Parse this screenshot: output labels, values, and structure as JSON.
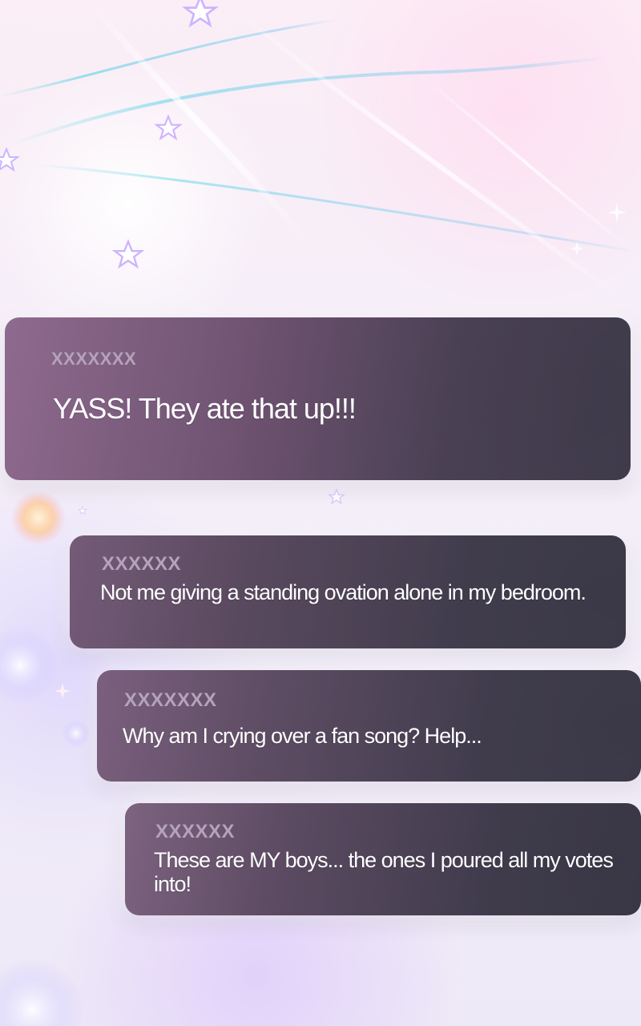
{
  "comments": [
    {
      "username": "XXXXXXX",
      "text": "YASS! They ate that up!!!"
    },
    {
      "username": "XXXXXX",
      "text": "Not me giving a standing ovation alone in my bedroom."
    },
    {
      "username": "XXXXXXX",
      "text": "Why am I crying over a fan song? Help..."
    },
    {
      "username": "XXXXXX",
      "text": "These are MY boys... the ones I poured all my votes into!"
    }
  ],
  "decor": {
    "icons": [
      "star-icon",
      "sparkle-icon",
      "orb-icon",
      "light-streak"
    ],
    "colors": {
      "bubble_purple": "#8e6a8f",
      "bubble_dark": "#433f50",
      "username": "#b4a3ba",
      "message": "#ffffff"
    }
  }
}
